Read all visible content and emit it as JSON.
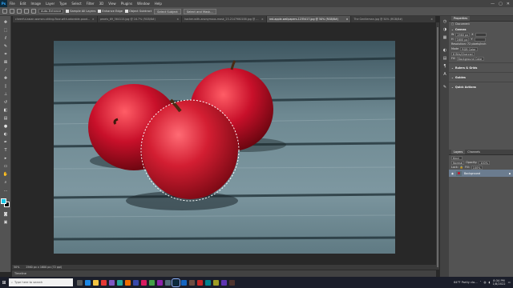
{
  "menubar": {
    "logo": "Ps",
    "items": [
      "File",
      "Edit",
      "Image",
      "Layer",
      "Type",
      "Select",
      "Filter",
      "3D",
      "View",
      "Plugins",
      "Window",
      "Help"
    ],
    "minimize": "—",
    "maximize": "▢",
    "close": "✕"
  },
  "options": {
    "mode": "Auto-Enhance",
    "sample_all_layers": "Sample All Layers",
    "enhance_edge": "Enhance Edge",
    "object_subtract": "Object Subtract",
    "select_subject": "Select Subject",
    "select_and_mask": "Select and Mask..."
  },
  "tabs": [
    {
      "label": "cheerful-asian-woman-sitting-floor-with-adorable-poodle.jpg @ 16.7% (RGB/8#)",
      "close": "×",
      "active": false
    },
    {
      "label": "pexels_69_564115.jpg @ 16.7% (RGB/8#)",
      "close": "×",
      "active": false
    },
    {
      "label": "hacker-with-anonymous-mask_23-2147980188.jpg @ 33.3% (RGB/8#)",
      "close": "×",
      "active": false
    },
    {
      "label": "red-apple-wallpapers-1235417.jpg @ 50% (RGB/8#)",
      "close": "×",
      "active": true
    },
    {
      "label": "The Gentleman.jpg @ 50% (RGB/8#)",
      "close": "×",
      "active": false
    }
  ],
  "status": {
    "zoom": "50%",
    "doc_size": "2560 px x 1600 px (72 ppi)"
  },
  "timeline": {
    "label": "Timeline"
  },
  "properties": {
    "tabs": [
      "Properties"
    ],
    "document_label": "Document",
    "canvas_head": "Canvas",
    "width_label": "W",
    "width_value": "2560 px",
    "height_label": "H",
    "height_value": "1600 px",
    "x_label": "X",
    "y_label": "Y",
    "resolution": "Resolution: 72 pixels/inch",
    "mode_label": "Mode",
    "mode_value": "RGB Color",
    "bits_value": "8 Bits/Channel",
    "fill_label": "Fill",
    "fill_value": "Background Color",
    "rulers_head": "Rulers & Grids",
    "guides_head": "Guides",
    "quick_actions_head": "Quick Actions"
  },
  "layers": {
    "tabs": [
      "Layers",
      "Channels"
    ],
    "kind_label": "Kind",
    "mode_value": "Normal",
    "opacity_label": "Opacity:",
    "opacity_value": "100%",
    "lock_label": "Lock:",
    "fill_label": "Fill:",
    "fill_value": "100%",
    "layer_name": "Background"
  },
  "taskbar": {
    "search_placeholder": "Type here to search",
    "weather": "64°F Partly clo...",
    "time": "8:34 PM",
    "date": "1/8/2022"
  },
  "colors": {
    "foreground": "#18c6e6",
    "background": "#000000",
    "accent": "#31a8ff"
  }
}
